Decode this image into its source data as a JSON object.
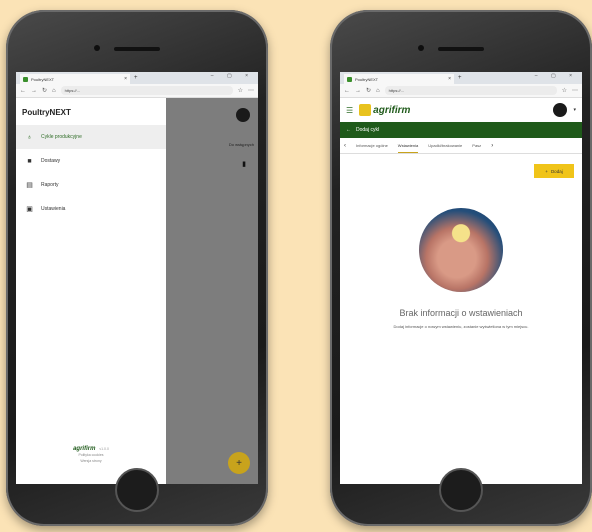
{
  "left_phone": {
    "browser": {
      "tab_title": "PoultryNEXT",
      "url": "https://..."
    },
    "drawer": {
      "title": "PoultryNEXT",
      "items": [
        {
          "label": "Cykle produkcyjne",
          "icon": "cycle-icon",
          "active": true
        },
        {
          "label": "Dostawy",
          "icon": "truck-icon",
          "active": false
        },
        {
          "label": "Raporty",
          "icon": "report-icon",
          "active": false
        },
        {
          "label": "Ustawienia",
          "icon": "settings-icon",
          "active": false
        }
      ],
      "footer": {
        "brand": "agrifirm",
        "version": "v1.0.0",
        "line1": "Polityka cookies",
        "line2": "Wersja strony"
      }
    },
    "overlay": {
      "text": "Do wstępnych",
      "fab": "+"
    }
  },
  "right_phone": {
    "browser": {
      "tab_title": "PoultryNEXT",
      "url": "https://..."
    },
    "header": {
      "brand": "agrifirm"
    },
    "greenbar": {
      "back": "←",
      "title": "Dodaj cykl"
    },
    "tabs": [
      {
        "label": "Informacje ogólne",
        "active": false
      },
      {
        "label": "Wstawienia",
        "active": true
      },
      {
        "label": "Upadki/brakowanie",
        "active": false
      },
      {
        "label": "Pasz",
        "active": false
      }
    ],
    "add_button": "Dodaj",
    "empty": {
      "title": "Brak informacji o wstawieniach",
      "subtitle": "Dodaj informacje o nowym wstawieniu, zostanie wyświetlona w tym miejscu."
    }
  },
  "colors": {
    "background": "#fbe3b6",
    "brand_green": "#1f5a1a",
    "accent_yellow": "#f0c419"
  }
}
